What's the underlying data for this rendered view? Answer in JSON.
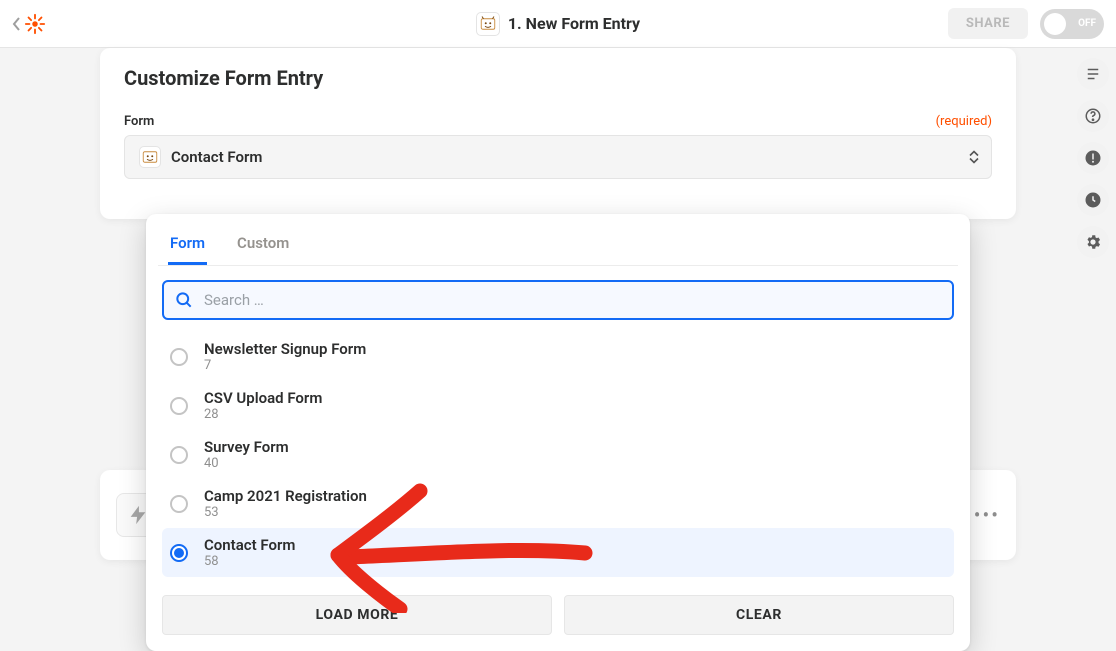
{
  "header": {
    "step_title": "1. New Form Entry",
    "share_label": "SHARE",
    "toggle_state": "OFF"
  },
  "panel": {
    "title": "Customize Form Entry",
    "field_label": "Form",
    "required_label": "(required)",
    "selected_value": "Contact Form"
  },
  "dropdown": {
    "tabs": {
      "form": "Form",
      "custom": "Custom"
    },
    "search_placeholder": "Search …",
    "options": [
      {
        "name": "Newsletter Signup Form",
        "id": "7",
        "selected": false
      },
      {
        "name": "CSV Upload Form",
        "id": "28",
        "selected": false
      },
      {
        "name": "Survey Form",
        "id": "40",
        "selected": false
      },
      {
        "name": "Camp 2021 Registration",
        "id": "53",
        "selected": false
      },
      {
        "name": "Contact Form",
        "id": "58",
        "selected": true
      }
    ],
    "load_more": "LOAD MORE",
    "clear": "CLEAR"
  },
  "rail": {
    "icons": [
      "outline-icon",
      "help-icon",
      "alert-icon",
      "history-icon",
      "settings-icon"
    ]
  },
  "colors": {
    "accent_orange": "#ff4f00",
    "accent_blue": "#136bf5"
  }
}
